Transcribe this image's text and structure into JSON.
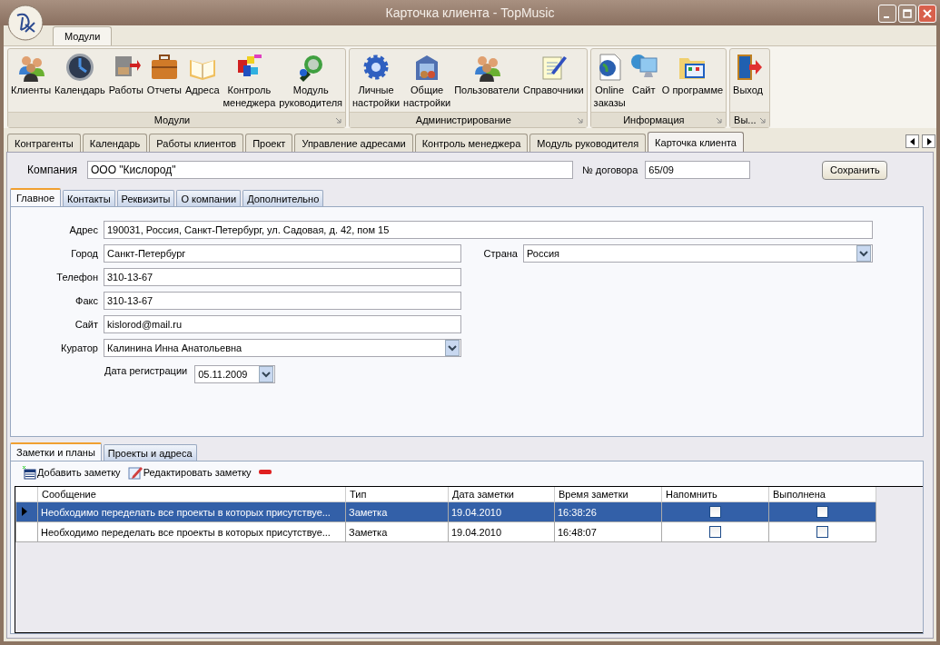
{
  "window": {
    "title": "Карточка клиента - TopMusic"
  },
  "ribbon": {
    "tabs": [
      {
        "label": "Модули",
        "selected": true
      }
    ],
    "groups": [
      {
        "label": "Модули",
        "items": [
          "Клиенты",
          "Календарь",
          "Работы",
          "Отчеты",
          "Адреса",
          "Контроль\nменеджера",
          "Модуль\nруководителя"
        ]
      },
      {
        "label": "Администрирование",
        "items": [
          "Личные\nнастройки",
          "Общие\nнастройки",
          "Пользователи",
          "Справочники"
        ]
      },
      {
        "label": "Информация",
        "items": [
          "Online\nзаказы",
          "Сайт",
          "О программе"
        ]
      },
      {
        "label": "Вы...",
        "items": [
          "Выход"
        ]
      }
    ]
  },
  "doc_tabs": [
    {
      "label": "Контрагенты",
      "selected": false
    },
    {
      "label": "Календарь",
      "selected": false
    },
    {
      "label": "Работы клиентов",
      "selected": false
    },
    {
      "label": "Проект",
      "selected": false
    },
    {
      "label": "Управление адресами",
      "selected": false
    },
    {
      "label": "Контроль менеджера",
      "selected": false
    },
    {
      "label": "Модуль руководителя",
      "selected": false
    },
    {
      "label": "Карточка клиента",
      "selected": true
    }
  ],
  "header": {
    "company_label": "Компания",
    "company": "ООО \"Кислород\"",
    "contract_label": "№ договора",
    "contract": "65/09",
    "save_button": "Сохранить"
  },
  "form_tabs": [
    {
      "label": "Главное",
      "selected": true
    },
    {
      "label": "Контакты",
      "selected": false
    },
    {
      "label": "Реквизиты",
      "selected": false
    },
    {
      "label": "О компании",
      "selected": false
    },
    {
      "label": "Дополнительно",
      "selected": false
    }
  ],
  "form_rows": [
    [
      {
        "label": "Адрес",
        "value": "190031, Россия, Санкт-Петербург, ул. Садовая, д. 42, пом 15",
        "kind": "wide"
      }
    ],
    [
      {
        "label": "Город",
        "value": "Санкт-Петербург",
        "kind": "text"
      },
      {
        "label": "Страна",
        "value": "Россия",
        "kind": "combo"
      }
    ],
    [
      {
        "label": "Телефон",
        "value": "310-13-67",
        "kind": "text"
      }
    ],
    [
      {
        "label": "Факс",
        "value": "310-13-67",
        "kind": "text"
      }
    ],
    [
      {
        "label": "Сайт",
        "value": "kislorod@mail.ru",
        "kind": "text"
      }
    ],
    [
      {
        "label": "Куратор",
        "value": "Калинина Инна Анатольевна",
        "kind": "combo"
      }
    ]
  ],
  "registration_date": {
    "label": "Дата регистрации",
    "value": "05.11.2009"
  },
  "notes_tabs": [
    {
      "label": "Заметки и планы",
      "selected": true
    },
    {
      "label": "Проекты и адреса",
      "selected": false
    }
  ],
  "toolbar": [
    {
      "label": "Добавить заметку",
      "kind": "add"
    },
    {
      "label": "Редактировать заметку",
      "kind": "edit"
    },
    {
      "kind": "delete"
    }
  ],
  "table": {
    "columns": [
      "Сообщение",
      "Тип",
      "Дата заметки",
      "Время заметки",
      "Напомнить",
      "Выполнена"
    ],
    "rows": [
      {
        "selected": true,
        "message": "Необходимо переделать все проекты в которых присутствуе...",
        "type": "Заметка",
        "date": "19.04.2010",
        "time": "16:38:26",
        "remind": false,
        "done": false
      },
      {
        "selected": false,
        "message": "Необходимо переделать все проекты в которых присутствуе...",
        "type": "Заметка",
        "date": "19.04.2010",
        "time": "16:48:07",
        "remind": false,
        "done": false
      }
    ]
  }
}
